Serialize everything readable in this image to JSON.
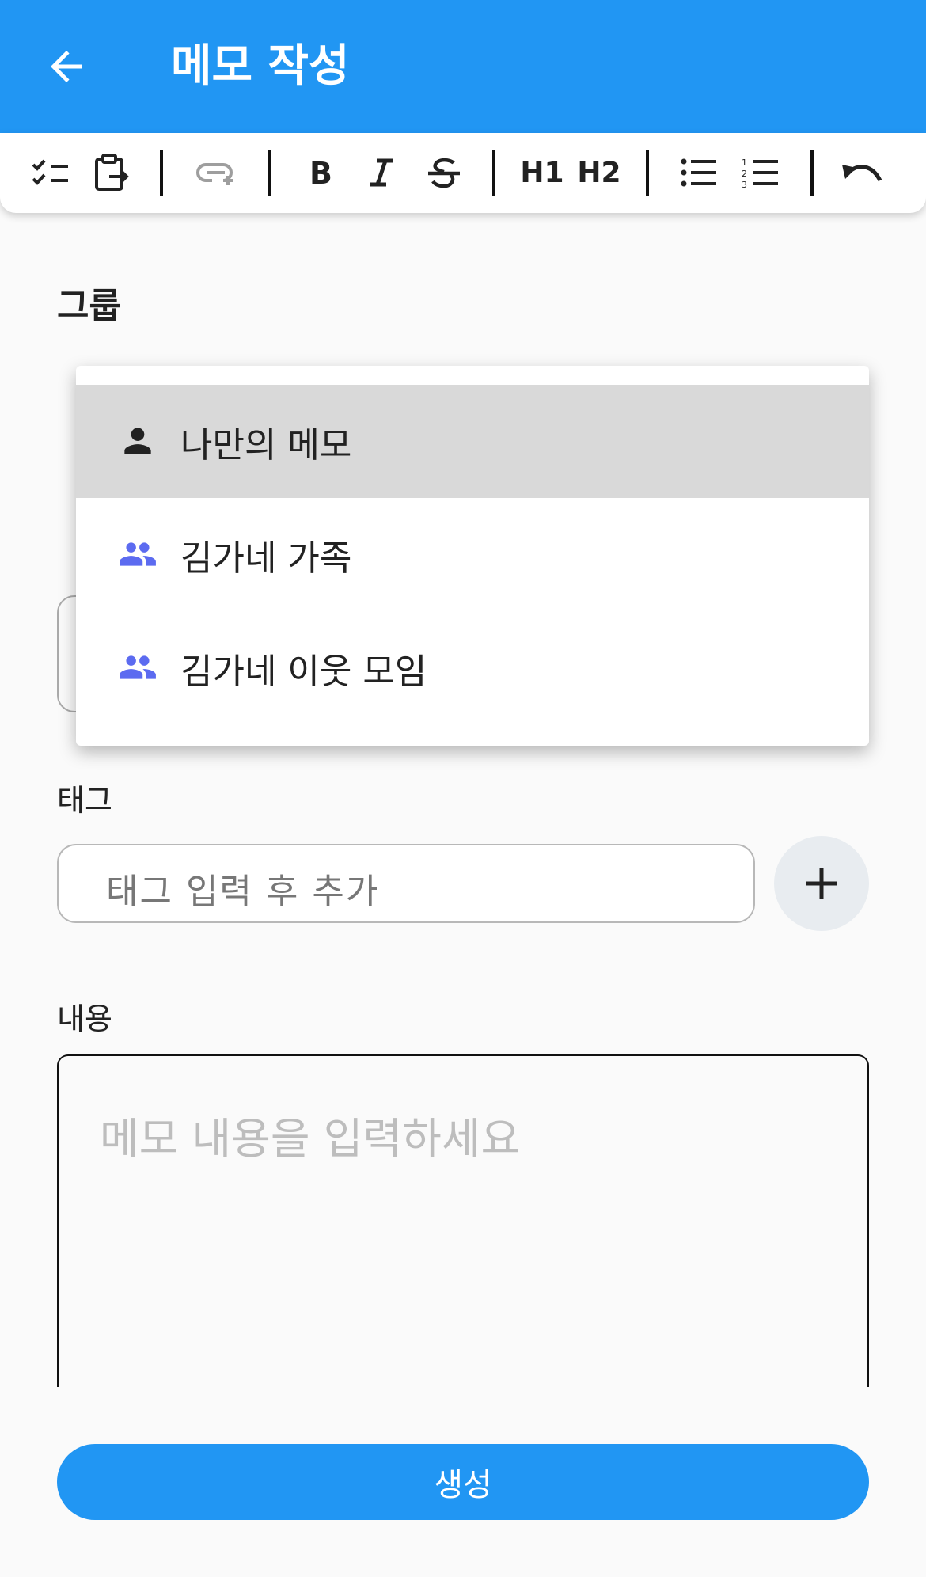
{
  "appbar": {
    "title": "메모 작성",
    "back_icon": "arrow-left-icon",
    "color": "#2196f3"
  },
  "toolbar": {
    "h1_label": "H1",
    "h2_label": "H2",
    "icons": [
      "checklist-icon",
      "paste-icon",
      "link-icon",
      "bold-icon",
      "italic-icon",
      "strikethrough-icon",
      "bullet-list-icon",
      "numbered-list-icon",
      "undo-icon"
    ]
  },
  "group": {
    "label": "그룹",
    "options": [
      {
        "label": "나만의 메모",
        "icon": "person-icon",
        "selected": true
      },
      {
        "label": "김가네 가족",
        "icon": "group-icon",
        "selected": false
      },
      {
        "label": "김가네 이웃 모임",
        "icon": "group-icon",
        "selected": false
      }
    ],
    "group_icon_color": "#5c6bf0"
  },
  "tag": {
    "label": "태그",
    "placeholder": "태그 입력 후 추가",
    "add_icon": "plus-icon"
  },
  "content": {
    "label": "내용",
    "placeholder": "메모 내용을 입력하세요"
  },
  "submit": {
    "label": "생성"
  }
}
